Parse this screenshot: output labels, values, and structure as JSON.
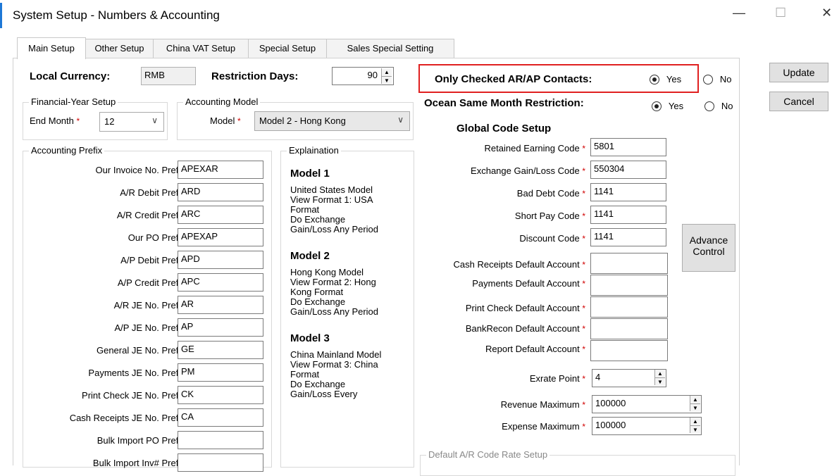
{
  "window": {
    "title": "System Setup - Numbers & Accounting",
    "minimize": "—",
    "maximize": "☐",
    "close": "✕"
  },
  "tabs": [
    "Main Setup",
    "Other Setup",
    "China VAT Setup",
    "Special Setup",
    "Sales Special Setting"
  ],
  "top": {
    "currency_label": "Local Currency:",
    "currency_value": "RMB",
    "restriction_label": "Restriction Days:",
    "restriction_value": "90",
    "only_checked_label": "Only Checked AR/AP Contacts:",
    "ocean_label": "Ocean Same Month Restriction:",
    "yes": "Yes",
    "no": "No"
  },
  "fy": {
    "group": "Financial-Year Setup",
    "end_month_label": "End Month",
    "end_month_value": "12"
  },
  "model": {
    "group": "Accounting Model",
    "label": "Model",
    "value": "Model 2 - Hong Kong"
  },
  "prefix": {
    "group": "Accounting Prefix",
    "rows": [
      {
        "label": "Our Invoice No. Prefix",
        "value": "APEXAR"
      },
      {
        "label": "A/R Debit Prefix",
        "value": "ARD"
      },
      {
        "label": "A/R Credit Prefix",
        "value": "ARC"
      },
      {
        "label": "Our PO Prefix",
        "value": "APEXAP"
      },
      {
        "label": "A/P Debit Prefix",
        "value": "APD"
      },
      {
        "label": "A/P Credit Prefix",
        "value": "APC"
      },
      {
        "label": "A/R JE No. Prefix",
        "value": "AR"
      },
      {
        "label": "A/P JE No. Prefix",
        "value": "AP"
      },
      {
        "label": "General JE No. Prefix",
        "value": "GE"
      },
      {
        "label": "Payments JE No. Prefix",
        "value": "PM"
      },
      {
        "label": "Print Check JE No. Prefix",
        "value": "CK"
      },
      {
        "label": "Cash Receipts JE No. Prefix",
        "value": "CA"
      },
      {
        "label": "Bulk Import PO Prefix",
        "value": ""
      },
      {
        "label": "Bulk Import Inv# Prefix",
        "value": ""
      }
    ]
  },
  "explain": {
    "group": "Explaination",
    "m1_title": "Model 1",
    "m1_l1": "United States Model",
    "m1_l2": "View Format 1: USA",
    "m1_l3": "Format",
    "m1_l4": "Do Exchange",
    "m1_l5": "Gain/Loss Any Period",
    "m2_title": "Model 2",
    "m2_l1": "Hong Kong Model",
    "m2_l2": "View Format 2: Hong",
    "m2_l3": "Kong Format",
    "m2_l4": "Do Exchange",
    "m2_l5": "Gain/Loss Any Period",
    "m3_title": "Model 3",
    "m3_l1": "China Mainland Model",
    "m3_l2": "View Format 3: China",
    "m3_l3": "Format",
    "m3_l4": "Do Exchange",
    "m3_l5": "Gain/Loss Every"
  },
  "global": {
    "title": "Global Code Setup",
    "codes": [
      {
        "label": "Retained Earning Code",
        "value": "5801"
      },
      {
        "label": "Exchange Gain/Loss Code",
        "value": "550304"
      },
      {
        "label": "Bad Debt Code",
        "value": "1141"
      },
      {
        "label": "Short Pay Code",
        "value": "1141"
      },
      {
        "label": "Discount Code",
        "value": "1141"
      }
    ],
    "accounts": [
      {
        "label": "Cash Receipts Default Account",
        "value": ""
      },
      {
        "label": "Payments Default Account",
        "value": ""
      },
      {
        "label": "Print Check Default Account",
        "value": ""
      },
      {
        "label": "BankRecon Default Account",
        "value": ""
      },
      {
        "label": "Report Default Account",
        "value": ""
      }
    ],
    "exrate_label": "Exrate Point",
    "exrate_value": "4",
    "revenue_label": "Revenue Maximum",
    "revenue_value": "100000",
    "expense_label": "Expense Maximum",
    "expense_value": "100000",
    "advance_l1": "Advance",
    "advance_l2": "Control",
    "ar_group": "Default A/R Code Rate Setup"
  },
  "buttons": {
    "update": "Update",
    "cancel": "Cancel"
  },
  "required_mark": "*",
  "spin_up": "▲",
  "spin_down": "▼",
  "chevron": "∨"
}
